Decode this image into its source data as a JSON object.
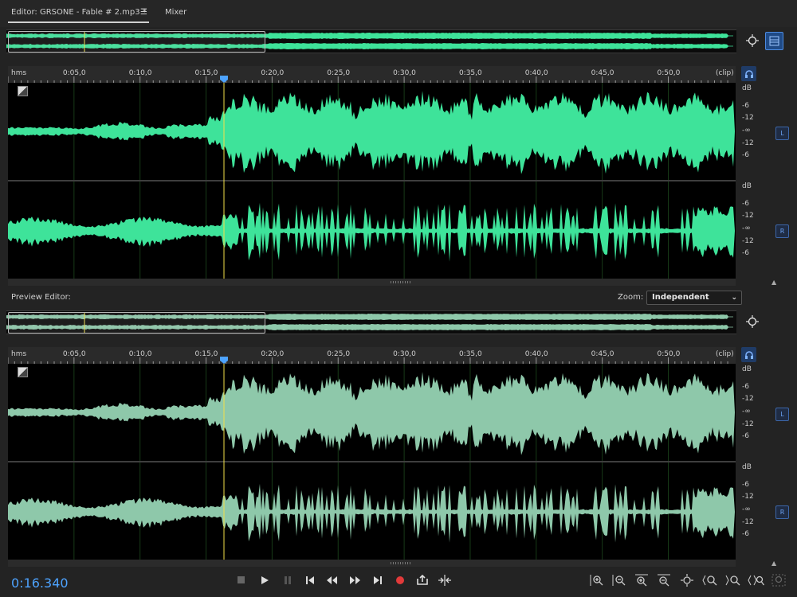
{
  "tabs": {
    "editor": "Editor: GRSONE - Fable # 2.mp3 *",
    "editor_menu": "☰",
    "mixer": "Mixer"
  },
  "ruler": {
    "unit": "hms",
    "ticks": [
      "0:05,0",
      "0:10,0",
      "0:15,0",
      "0:20,0",
      "0:25,0",
      "0:30,0",
      "0:35,0",
      "0:40,0",
      "0:45,0",
      "0:50,0"
    ],
    "end": "(clip)"
  },
  "channels": {
    "left": {
      "label": "L",
      "db": [
        "dB",
        "-6",
        "-12",
        "-∞",
        "-12",
        "-6"
      ]
    },
    "right": {
      "label": "R",
      "db": [
        "dB",
        "-6",
        "-12",
        "-∞",
        "-12",
        "-6"
      ]
    }
  },
  "preview": {
    "label": "Preview Editor:",
    "zoom_label": "Zoom:",
    "zoom_value": "Independent"
  },
  "playhead": {
    "time_seconds": 16.34
  },
  "timecode": "0:16.340",
  "colors": {
    "waveform": "#3ee39a",
    "preview_waveform": "#8ec8aa",
    "playhead": "#f2e14a",
    "accent": "#4da3ff",
    "record": "#e23a3a"
  },
  "transport": [
    "stop-icon",
    "play-icon",
    "pause-icon",
    "go-to-start-icon",
    "rewind-icon",
    "fast-forward-icon",
    "go-to-end-icon",
    "record-icon",
    "loop-icon",
    "skip-selection-icon"
  ],
  "zoom_tools": [
    "zoom-in-amplitude-icon",
    "zoom-out-amplitude-icon",
    "zoom-in-time-icon",
    "zoom-out-time-icon",
    "zoom-full-icon",
    "zoom-in-left-icon",
    "zoom-in-right-icon",
    "zoom-selection-icon",
    "zoom-out-full-icon"
  ]
}
